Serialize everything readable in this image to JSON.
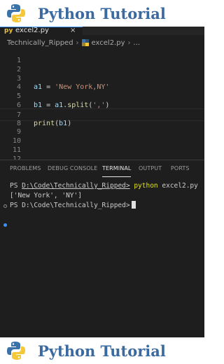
{
  "banner": {
    "title": "Python Tutorial"
  },
  "editor": {
    "tab": {
      "icon_label": "py",
      "filename": "excel2.py",
      "close": "×"
    },
    "breadcrumb": {
      "folder": "Technically_Ripped",
      "file": "excel2.py",
      "more": "..."
    },
    "lines": [
      {
        "num": "1",
        "tokens": []
      },
      {
        "num": "2",
        "tokens": []
      },
      {
        "num": "3",
        "tokens": []
      },
      {
        "num": "4",
        "tokens": [
          {
            "t": "a1",
            "c": "var"
          },
          {
            "t": " = ",
            "c": "op"
          },
          {
            "t": "'New York,NY'",
            "c": "str"
          }
        ]
      },
      {
        "num": "5",
        "tokens": []
      },
      {
        "num": "6",
        "tokens": [
          {
            "t": "b1",
            "c": "var"
          },
          {
            "t": " = ",
            "c": "op"
          },
          {
            "t": "a1",
            "c": "var"
          },
          {
            "t": ".",
            "c": "op"
          },
          {
            "t": "split",
            "c": "fn"
          },
          {
            "t": "(",
            "c": "op"
          },
          {
            "t": "','",
            "c": "str"
          },
          {
            "t": ")",
            "c": "op"
          }
        ]
      },
      {
        "num": "7",
        "tokens": [],
        "active": true
      },
      {
        "num": "8",
        "tokens": [
          {
            "t": "print",
            "c": "fn"
          },
          {
            "t": "(",
            "c": "op"
          },
          {
            "t": "b1",
            "c": "var"
          },
          {
            "t": ")",
            "c": "op"
          }
        ]
      },
      {
        "num": "9",
        "tokens": []
      },
      {
        "num": "10",
        "tokens": []
      },
      {
        "num": "11",
        "tokens": []
      },
      {
        "num": "12",
        "tokens": []
      }
    ]
  },
  "panel": {
    "tabs": [
      "PROBLEMS",
      "DEBUG CONSOLE",
      "TERMINAL",
      "OUTPUT",
      "PORTS"
    ],
    "active_tab": "TERMINAL",
    "terminal": {
      "line1_prefix": "PS ",
      "line1_path": "D:\\Code\\Technically_Ripped>",
      "line1_cmd": " python",
      "line1_args": " excel2.py",
      "line2": "['New York', 'NY']",
      "line3": "PS D:\\Code\\Technically_Ripped>"
    }
  },
  "colors": {
    "accent": "#3794ff",
    "editor_bg": "#1e1e1e",
    "banner_text": "#3a6aa0"
  },
  "icons": [
    "python-logo-icon",
    "python-file-icon",
    "close-icon",
    "chevron-right-icon",
    "terminal-cursor"
  ]
}
